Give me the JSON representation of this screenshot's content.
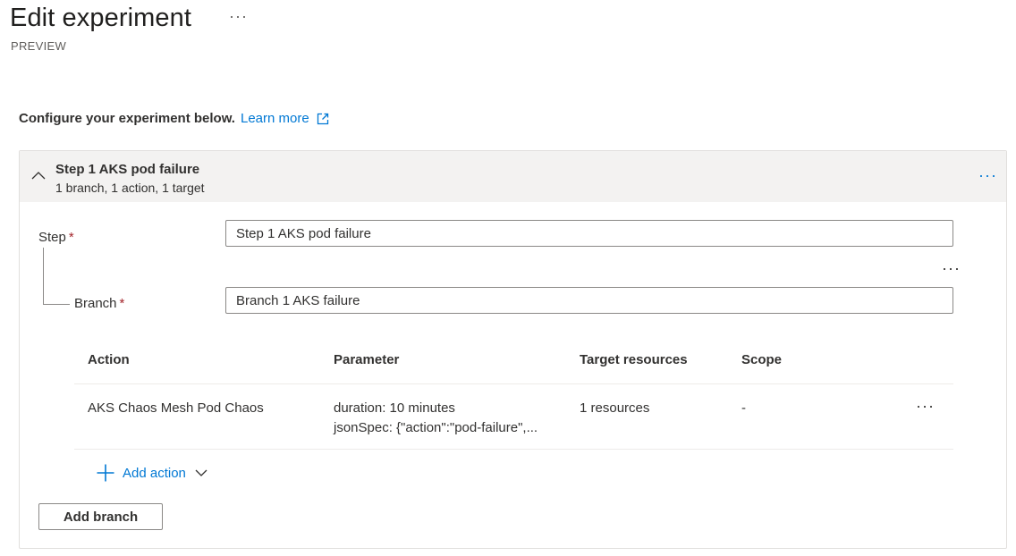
{
  "header": {
    "title": "Edit experiment",
    "more_label": "···",
    "subtitle": "PREVIEW"
  },
  "intro": {
    "text": "Configure your experiment below.",
    "link_label": "Learn more",
    "link_icon": "external-link-icon"
  },
  "step": {
    "title": "Step 1 AKS pod failure",
    "summary": "1 branch, 1 action, 1 target",
    "more_label": "···",
    "collapse_icon": "chevron-up-icon",
    "step_label": "Step",
    "step_value": "Step 1 AKS pod failure",
    "branch_label": "Branch",
    "branch_value": "Branch 1 AKS failure",
    "required_marker": "*",
    "branch_more_label": "···"
  },
  "table": {
    "columns": [
      "Action",
      "Parameter",
      "Target resources",
      "Scope"
    ],
    "rows": [
      {
        "action": "AKS Chaos Mesh Pod Chaos",
        "parameter_1": "duration: 10 minutes",
        "parameter_2": "jsonSpec: {\"action\":\"pod-failure\",...",
        "target": "1 resources",
        "scope": "-",
        "more_label": "···"
      }
    ]
  },
  "actions": {
    "add_action_label": "Add action",
    "add_branch_label": "Add branch"
  },
  "colors": {
    "accent": "#0078d4",
    "required": "#a4262c",
    "header_bg": "#f3f2f1"
  }
}
